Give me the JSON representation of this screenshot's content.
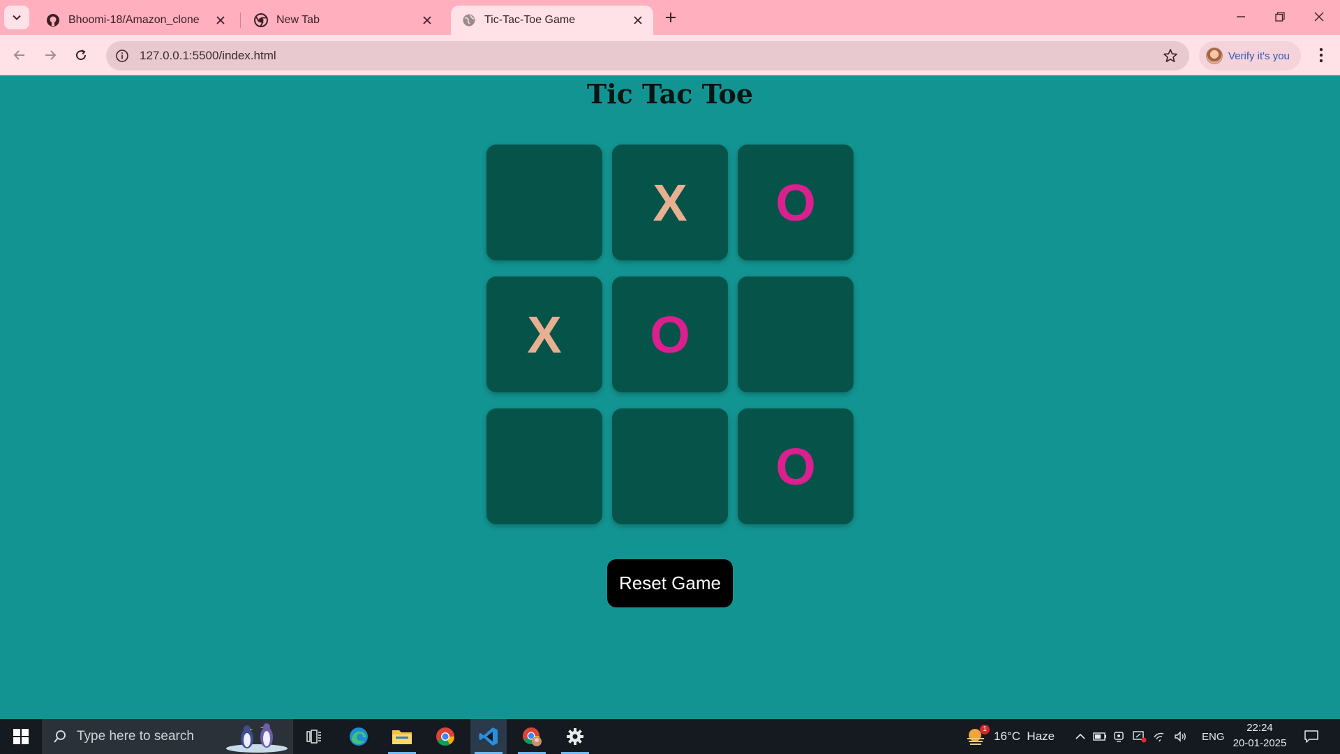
{
  "browser": {
    "tabs": [
      {
        "title": "Bhoomi-18/Amazon_clone",
        "icon": "github-icon",
        "active": false
      },
      {
        "title": "New Tab",
        "icon": "chrome-icon",
        "active": false
      },
      {
        "title": "Tic-Tac-Toe Game",
        "icon": "globe-icon",
        "active": true
      }
    ],
    "url": "127.0.0.1:5500/index.html",
    "profile_label": "Verify it's you"
  },
  "game": {
    "title": "Tic Tac Toe",
    "board": [
      "",
      "X",
      "O",
      "X",
      "O",
      "",
      "",
      "",
      "O"
    ],
    "reset_label": "Reset Game",
    "colors": {
      "x": "#e8b090",
      "o": "#db1f8f",
      "cell": "#06534a",
      "background": "#129592"
    }
  },
  "taskbar": {
    "search_placeholder": "Type here to search",
    "apps": [
      "task-view-icon",
      "edge-icon",
      "file-explorer-icon",
      "chrome-icon",
      "vscode-icon",
      "chrome-profile-icon",
      "settings-icon"
    ],
    "weather": "16°C  Haze",
    "weather_badge": "1",
    "language": "ENG",
    "time": "22:24",
    "date": "20-01-2025"
  }
}
